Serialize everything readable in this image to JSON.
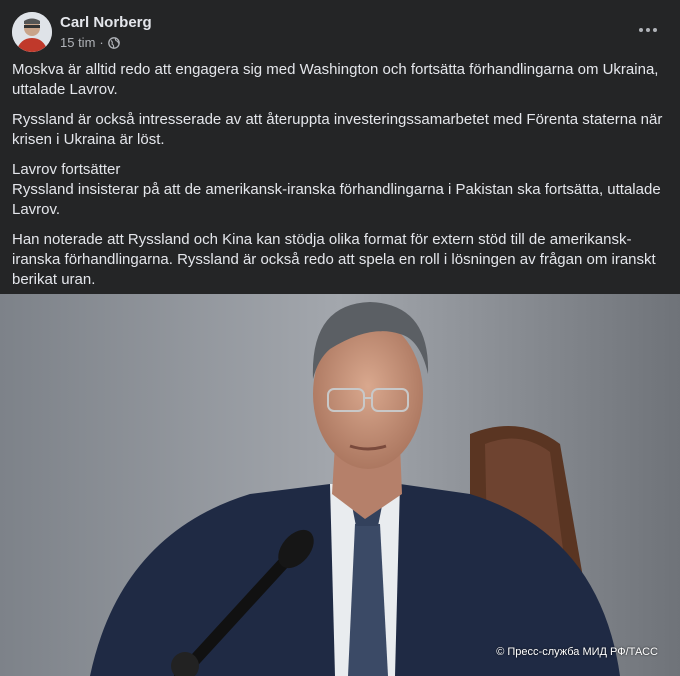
{
  "post": {
    "author": "Carl Norberg",
    "time": "15 tim",
    "separator": "·",
    "privacy_icon": "globe-icon",
    "more_icon": "more-horizontal-icon",
    "paragraphs": [
      "Moskva är alltid redo att engagera sig med Washington och fortsätta förhandlingarna om Ukraina, uttalade Lavrov.",
      "Ryssland är också intresserade av att återuppta investeringssamarbetet med Förenta staterna när krisen i Ukraina är löst.",
      "Lavrov fortsätter\nRyssland insisterar på att de amerikansk-iranska förhandlingarna i Pakistan ska fortsätta, uttalade Lavrov.",
      "Han noterade att Ryssland och Kina kan stödja olika format för extern stöd till de amerikansk-iranska förhandlingarna. Ryssland är också redo att spela en roll i lösningen av frågan om iranskt berikat uran."
    ],
    "photo_credit": "© Пресс-служба МИД РФ/ТАСС"
  },
  "colors": {
    "background": "#242526",
    "text_primary": "#e4e6eb",
    "text_secondary": "#b0b3b8"
  }
}
